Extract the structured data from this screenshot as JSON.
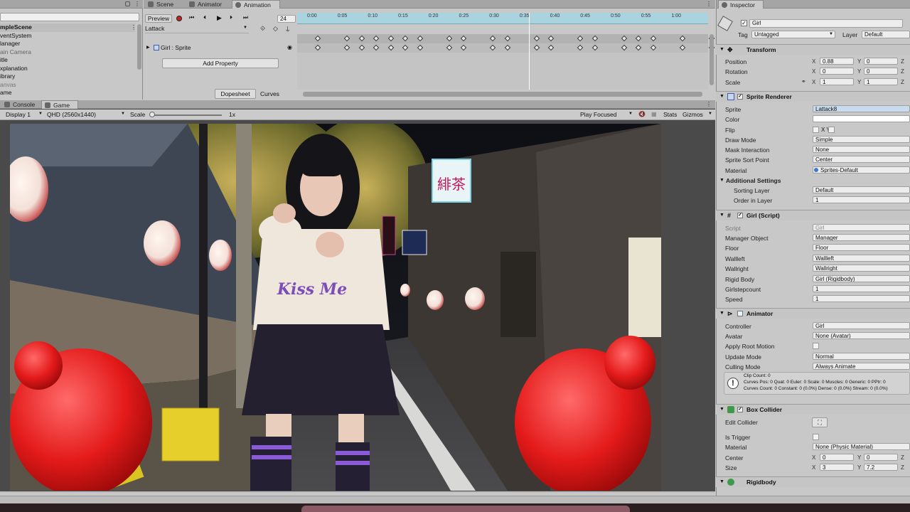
{
  "hierarchy": {
    "items": [
      "mpleScene",
      "ventSystem",
      "lanager",
      "ain Camera",
      "itle",
      "xplanation",
      "ibrary",
      "anvas",
      "ame"
    ],
    "dimmed": [
      3,
      7
    ]
  },
  "tabs_top": [
    "Scene",
    "Animator",
    "Animation"
  ],
  "animation": {
    "preview_label": "Preview",
    "frame_value": "24",
    "clip_name": "Lattack",
    "property": "Girl : Sprite",
    "add_property": "Add Property",
    "dopesheet": "Dopesheet",
    "curves": "Curves",
    "ruler": [
      "0:00",
      "0:05",
      "0:10",
      "0:15",
      "0:20",
      "0:25",
      "0:30",
      "0:35",
      "0:40",
      "0:45",
      "0:50",
      "0:55",
      "1:00"
    ]
  },
  "tabs_bottom": [
    "Console",
    "Game"
  ],
  "game_toolbar": {
    "display": "Display 1",
    "resolution": "QHD (2560x1440)",
    "scale_label": "Scale",
    "scale_value": "1x",
    "play_mode": "Play Focused",
    "stats": "Stats",
    "gizmos": "Gizmos"
  },
  "scene_text": {
    "shirt": "Kiss Me",
    "sign_vertical": "緋茶"
  },
  "inspector": {
    "tab": "Inspector",
    "object_name": "Girl",
    "tag_label": "Tag",
    "tag_value": "Untagged",
    "layer_label": "Layer",
    "layer_value": "Default",
    "transform": {
      "title": "Transform",
      "position_label": "Position",
      "position": [
        "0.88",
        "0"
      ],
      "rotation_label": "Rotation",
      "rotation": [
        "0",
        "0"
      ],
      "scale_label": "Scale",
      "scale": [
        "1",
        "1"
      ]
    },
    "sprite_renderer": {
      "title": "Sprite Renderer",
      "rows": [
        {
          "label": "Sprite",
          "value": "Lattack8"
        },
        {
          "label": "Color",
          "value": ""
        },
        {
          "label": "Flip",
          "value": "X  Y"
        },
        {
          "label": "Draw Mode",
          "value": "Simple"
        },
        {
          "label": "Mask Interaction",
          "value": "None"
        },
        {
          "label": "Sprite Sort Point",
          "value": "Center"
        },
        {
          "label": "Material",
          "value": "Sprites-Default"
        }
      ],
      "additional": "Additional Settings",
      "sorting_layer_label": "Sorting Layer",
      "sorting_layer": "Default",
      "order_label": "Order in Layer",
      "order": "1"
    },
    "girl_script": {
      "title": "Girl (Script)",
      "rows": [
        {
          "label": "Script",
          "value": "Girl"
        },
        {
          "label": "Manager Object",
          "value": "Manager"
        },
        {
          "label": "Floor",
          "value": "Floor"
        },
        {
          "label": "Wallleft",
          "value": "Wallleft"
        },
        {
          "label": "Wallright",
          "value": "Wallright"
        },
        {
          "label": "Rigid Body",
          "value": "Girl (Rigidbody)"
        },
        {
          "label": "Girlstepcount",
          "value": "1"
        },
        {
          "label": "Speed",
          "value": "1"
        }
      ]
    },
    "animator": {
      "title": "Animator",
      "rows": [
        {
          "label": "Controller",
          "value": "Girl"
        },
        {
          "label": "Avatar",
          "value": "None (Avatar)"
        },
        {
          "label": "Apply Root Motion",
          "value": ""
        },
        {
          "label": "Update Mode",
          "value": "Normal"
        },
        {
          "label": "Culling Mode",
          "value": "Always Animate"
        }
      ],
      "info": [
        "Clip Count: 0",
        "Curves Pos: 0 Quat: 0 Euler: 0 Scale: 0 Muscles: 0 Generic: 0 PPtr: 0",
        "Curves Count: 0 Constant: 0 (0.0%) Dense: 0 (0.0%) Stream: 0 (0.0%)"
      ]
    },
    "box_collider": {
      "title": "Box Collider",
      "edit_label": "Edit Collider",
      "trigger_label": "Is Trigger",
      "material_label": "Material",
      "material": "None (Physic Material)",
      "center_label": "Center",
      "center": [
        "0",
        "0"
      ],
      "size_label": "Size",
      "size": [
        "3",
        "7.2"
      ]
    },
    "rigidbody": {
      "title": "Rigidbody"
    }
  },
  "colors": {
    "accent": "#3a79d4",
    "panel": "#c8c8c8",
    "timeline": "#aad3e0"
  }
}
